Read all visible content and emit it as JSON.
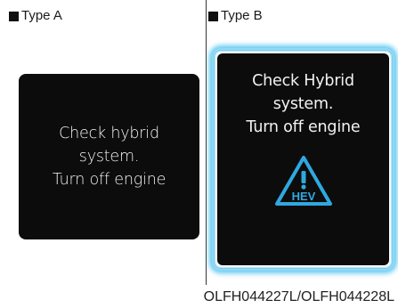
{
  "panels": [
    {
      "label": "Type A",
      "message_lines": [
        "Check hybrid",
        "system.",
        "Turn off engine"
      ]
    },
    {
      "label": "Type B",
      "message_lines": [
        "Check Hybrid",
        "system.",
        "Turn off engine"
      ],
      "warning_badge": "HEV",
      "warning_icon": "hev-warning-triangle-icon",
      "accent_color": "#2fa8e0"
    }
  ],
  "caption": "OLFH044227L/OLFH044228L"
}
